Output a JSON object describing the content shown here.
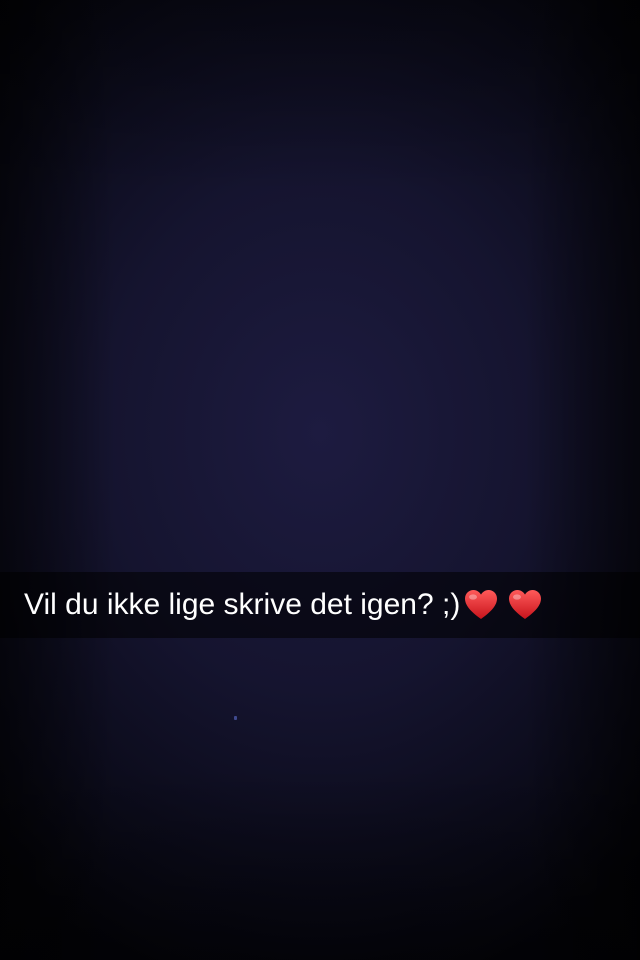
{
  "caption": {
    "text": "Vil du ikke lige skrive det igen? ;)",
    "emojis": [
      "heart-emoji",
      "heart-emoji"
    ],
    "emoji_color": "#e0262b"
  },
  "colors": {
    "background": "#15142f",
    "caption_bar": "rgba(0,0,0,0.55)",
    "caption_text": "#ffffff"
  }
}
